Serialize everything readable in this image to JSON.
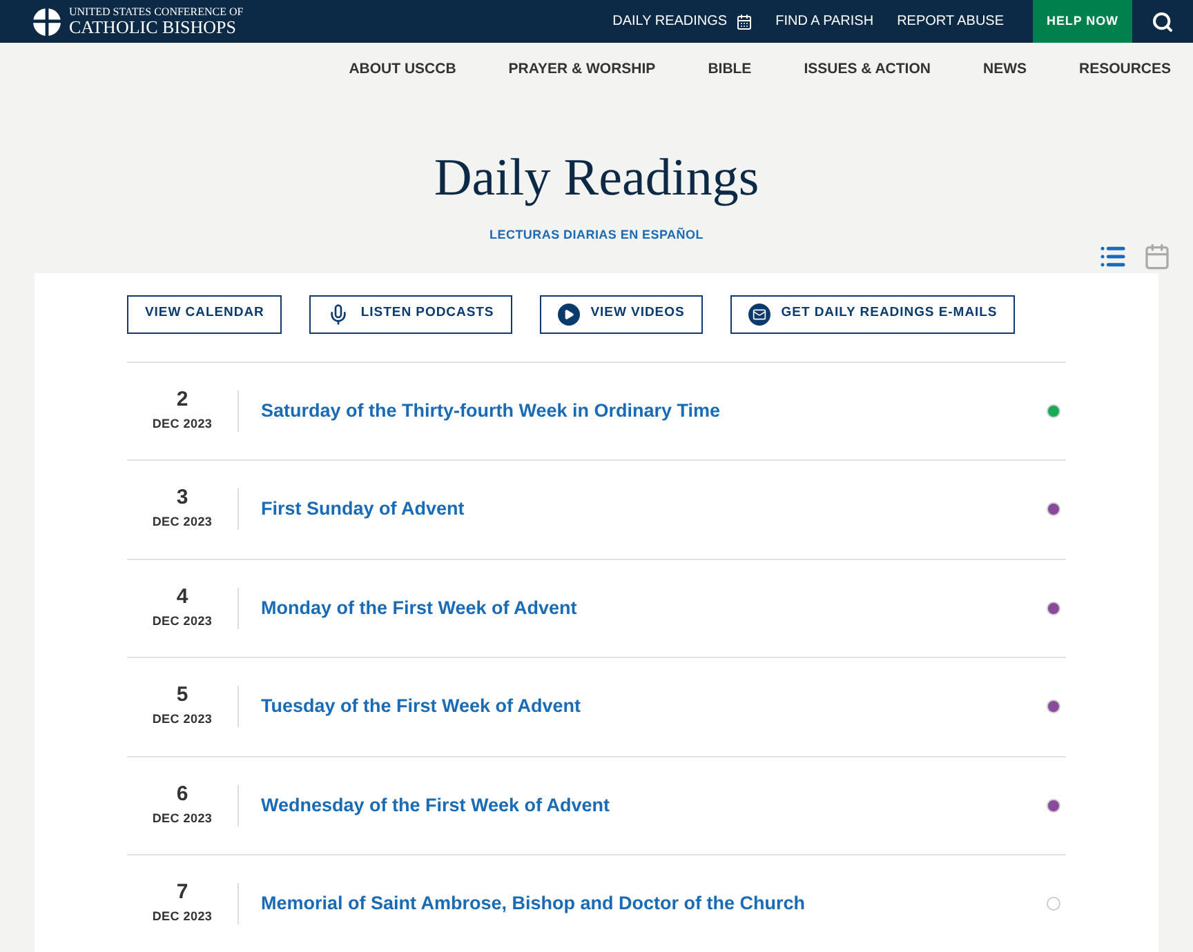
{
  "header": {
    "logo_line_1": "UNITED STATES CONFERENCE OF",
    "logo_line_2": "CATHOLIC BISHOPS",
    "links": [
      "DAILY READINGS",
      "FIND A PARISH",
      "REPORT ABUSE"
    ],
    "help_button": "HELP NOW"
  },
  "nav": [
    "ABOUT USCCB",
    "PRAYER & WORSHIP",
    "BIBLE",
    "ISSUES & ACTION",
    "NEWS",
    "RESOURCES"
  ],
  "title": "Daily Readings",
  "subtitle": "LECTURAS DIARIAS EN ESPAÑOL",
  "view_toggle": [
    {
      "kind": "list",
      "selected": true
    },
    {
      "kind": "calendar",
      "selected": false
    }
  ],
  "actions": [
    {
      "kind": "plain",
      "label": "VIEW CALENDAR"
    },
    {
      "kind": "mic",
      "label": "LISTEN PODCASTS"
    },
    {
      "kind": "play",
      "label": "VIEW VIDEOS"
    },
    {
      "kind": "mail",
      "label": "GET DAILY READINGS E-MAILS"
    }
  ],
  "readings": [
    {
      "day": "2",
      "month_year": "DEC 2023",
      "title": "Saturday of the Thirty-fourth Week in Ordinary Time",
      "color": "#1aaa55"
    },
    {
      "day": "3",
      "month_year": "DEC 2023",
      "title": "First Sunday of Advent",
      "color": "#8a4a9c"
    },
    {
      "day": "4",
      "month_year": "DEC 2023",
      "title": "Monday of the First Week of Advent",
      "color": "#8a4a9c"
    },
    {
      "day": "5",
      "month_year": "DEC 2023",
      "title": "Tuesday of the First Week of Advent",
      "color": "#8a4a9c"
    },
    {
      "day": "6",
      "month_year": "DEC 2023",
      "title": "Wednesday of the First Week of Advent",
      "color": "#8a4a9c"
    },
    {
      "day": "7",
      "month_year": "DEC 2023",
      "title": "Memorial of Saint Ambrose, Bishop and Doctor of the Church",
      "color": "#ffffff"
    }
  ]
}
